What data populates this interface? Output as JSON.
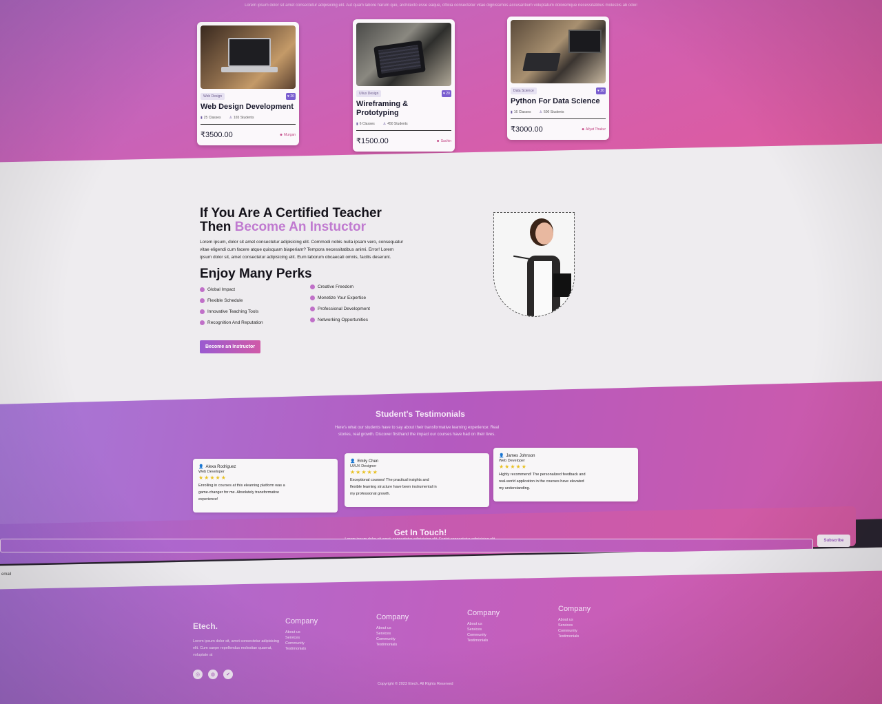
{
  "courses": {
    "subtitle": "Lorem ipsum dolor sit amet consectetur adipisicing elit. Aut quam labore harum quo, architecto esse eaque, officia consectetur vitae dignissimos accusantium voluptatum doloremque necessitatibus molestiis ab odio!",
    "items": [
      {
        "tag": "Web Design",
        "title": "Web Design Development",
        "classes": "25 Classes",
        "students": "165 Students",
        "price": "₹3500.00",
        "instructor": "Murgan"
      },
      {
        "tag": "Ui/ux Design",
        "title": "Wireframing & Prototyping",
        "classes": "6 Classes",
        "students": "450 Students",
        "price": "₹1500.00",
        "instructor": "Sachin"
      },
      {
        "tag": "Data Science",
        "title": "Python For Data Science",
        "classes": "16 Classes",
        "students": "500 Students",
        "price": "₹3000.00",
        "instructor": "Allyat Thakur"
      }
    ],
    "badge": "♥ 20"
  },
  "instructor": {
    "heading_line1": "If You Are A Certified Teacher",
    "heading_then": "Then ",
    "heading_accent": "Become An Instuctor",
    "paragraph": "Lorem ipsum, dolor sit amet consectetur adipisicing elit. Commodi nobis nulla ipsam vero, consequatur vitae eligendi cum facere atque quisquam biaperiam? Tempora necessitatibus animi. Error! Lorem ipsum dolor sit, amet consectetur adipisicing elit. Eum laborum obcaecati omnis, facilis deserunt.",
    "perks_heading": "Enjoy Many Perks",
    "perks": [
      "Global Impact",
      "Creative Freedom",
      "Flexible Schedule",
      "Monetize Your Expertise",
      "Innovative Teaching Tools",
      "Professional Development",
      "Recognition And Reputation",
      "Networking Opportunities"
    ],
    "button": "Become an Instructor"
  },
  "testimonials": {
    "title": "Student's Testimonials",
    "subtitle": "Here's what our students have to say about their transformative learning experience: Real stories, real growth. Discover firsthand the impact our courses have had on their lives.",
    "items": [
      {
        "name": "Alexa Rodriguez",
        "role": "Web Developer",
        "stars": "★★★★★",
        "text": "Enrolling in courses at this elearning platform was a game-changer for me. Absolutely transformative experience!"
      },
      {
        "name": "Emily Chen",
        "role": "UI/UX Designer",
        "stars": "★★★★★",
        "text": "Exceptional courses! The practical insights and flexible learning structure have been instrumental in my professional growth."
      },
      {
        "name": "James Johnson",
        "role": "Web Developer",
        "stars": "★★★★★",
        "text": "Highly recommend! The personalized feedback and real-world application in the courses have elevated my understanding."
      }
    ]
  },
  "touch": {
    "title": "Get In Touch!",
    "subtitle": "Lorem ipsum dolor sit amet, consectetur adipisicing elit. Fugiat,consectetur adipisicing elit.",
    "input_placeholder": "",
    "subscribe": "Subscribe",
    "strip_text": "email"
  },
  "footer": {
    "brand": "Etech.",
    "about": "Lorem ipsum dolor sit, amet consectetur adipisicing elit. Cum saepe repellendus molestiae quaerat, voluptate at",
    "social_icons": [
      "instagram-icon",
      "globe-icon",
      "twitter-icon"
    ],
    "columns": [
      {
        "title": "Company",
        "links": [
          "About us",
          "Services",
          "Community",
          "Testimonials"
        ]
      },
      {
        "title": "Company",
        "links": [
          "About us",
          "Services",
          "Community",
          "Testimonials"
        ]
      },
      {
        "title": "Company",
        "links": [
          "About us",
          "Services",
          "Community",
          "Testimonials"
        ]
      },
      {
        "title": "Company",
        "links": [
          "About us",
          "Services",
          "Community",
          "Testimonials"
        ]
      }
    ],
    "copyright": "Copyright © 2023 Etech. All Rights Reserved"
  },
  "colors": {
    "accent": "#c07ad0",
    "band": "#d25fb0",
    "star": "#e8c020"
  }
}
